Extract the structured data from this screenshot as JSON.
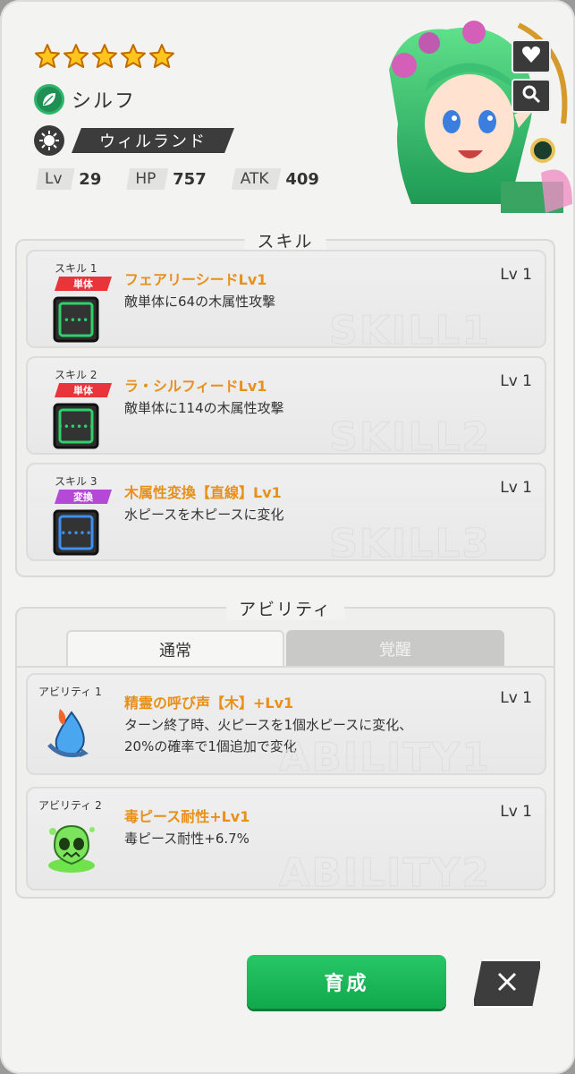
{
  "character": {
    "stars": 5,
    "name": "シルフ",
    "region": "ウィルランド",
    "element_icon": "leaf-icon",
    "region_icon": "sun-gear-icon",
    "stats": [
      {
        "label": "Lv",
        "value": "29"
      },
      {
        "label": "HP",
        "value": "757"
      },
      {
        "label": "ATK",
        "value": "409"
      }
    ]
  },
  "side_buttons": {
    "favorite_icon": "heart-icon",
    "zoom_icon": "magnifier-icon"
  },
  "skills": {
    "title": "スキル",
    "items": [
      {
        "slot": "スキル 1",
        "tag": "単体",
        "tag_color": "#e8343a",
        "name": "フェアリーシードLv1",
        "desc": "敵単体に64の木属性攻撃",
        "level": "Lv 1",
        "watermark": "SKILL1",
        "icon_color": "#2fd06b",
        "dots": "••••"
      },
      {
        "slot": "スキル 2",
        "tag": "単体",
        "tag_color": "#e8343a",
        "name": "ラ・シルフィードLv1",
        "desc": "敵単体に114の木属性攻撃",
        "level": "Lv 1",
        "watermark": "SKILL2",
        "icon_color": "#2fd06b",
        "dots": "••••••"
      },
      {
        "slot": "スキル 3",
        "tag": "変換",
        "tag_color": "#b648d8",
        "name": "木属性変換【直線】Lv1",
        "desc": "水ピースを木ピースに変化",
        "level": "Lv 1",
        "watermark": "SKILL3",
        "icon_color": "#3d8ff0",
        "dots": "•••••"
      }
    ]
  },
  "abilities": {
    "title": "アビリティ",
    "tabs": [
      {
        "label": "通常",
        "active": true
      },
      {
        "label": "覚醒",
        "active": false
      }
    ],
    "items": [
      {
        "slot": "アビリティ 1",
        "name": "精霊の呼び声【木】+Lv1",
        "desc_lines": [
          "ターン終了時、火ピースを1個水ピースに変化、",
          "20%の確率で1個追加で変化"
        ],
        "level": "Lv 1",
        "watermark": "ABILITY1",
        "icon": "fire-to-water-icon"
      },
      {
        "slot": "アビリティ 2",
        "name": "毒ピース耐性+Lv1",
        "desc_lines": [
          "毒ピース耐性+6.7%"
        ],
        "level": "Lv 1",
        "watermark": "ABILITY2",
        "icon": "poison-skull-icon"
      }
    ]
  },
  "buttons": {
    "train": "育成",
    "close_icon": "close-icon"
  }
}
